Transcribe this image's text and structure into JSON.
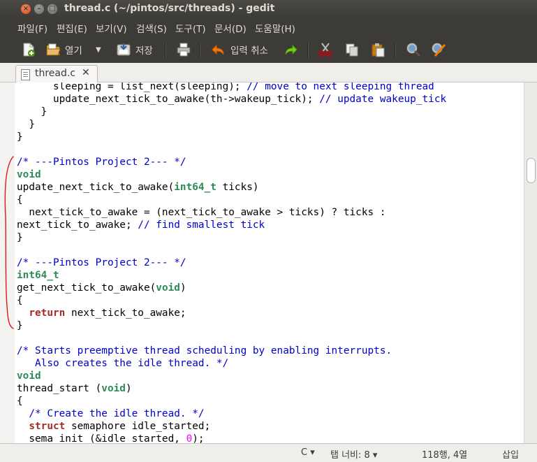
{
  "window": {
    "title": "thread.c (~/pintos/src/threads) - gedit"
  },
  "menu": {
    "items": [
      "파일(F)",
      "편집(E)",
      "보기(V)",
      "검색(S)",
      "도구(T)",
      "문서(D)",
      "도움말(H)"
    ]
  },
  "toolbar": {
    "open_label": "열기",
    "save_label": "저장",
    "undo_label": "입력 취소"
  },
  "tab": {
    "name": "thread.c",
    "close": "✕"
  },
  "code": {
    "lines": [
      [
        {
          "t": "      sleeping = list_next(sleeping); "
        },
        {
          "t": "// move to next sleeping thread",
          "c": "comment"
        }
      ],
      [
        {
          "t": "      update_next_tick_to_awake(th->wakeup_tick); "
        },
        {
          "t": "// update wakeup_tick",
          "c": "comment"
        }
      ],
      [
        {
          "t": "    }"
        }
      ],
      [
        {
          "t": "  }"
        }
      ],
      [
        {
          "t": "}"
        }
      ],
      [
        {
          "t": ""
        }
      ],
      [
        {
          "t": "/* ---Pintos Project 2--- */",
          "c": "comment"
        }
      ],
      [
        {
          "t": "void",
          "c": "type"
        }
      ],
      [
        {
          "t": "update_next_tick_to_awake("
        },
        {
          "t": "int64_t",
          "c": "type"
        },
        {
          "t": " ticks)"
        }
      ],
      [
        {
          "t": "{"
        }
      ],
      [
        {
          "t": "  next_tick_to_awake = (next_tick_to_awake > ticks) ? ticks :"
        }
      ],
      [
        {
          "t": "next_tick_to_awake; "
        },
        {
          "t": "// find smallest tick",
          "c": "comment"
        }
      ],
      [
        {
          "t": "}"
        }
      ],
      [
        {
          "t": ""
        }
      ],
      [
        {
          "t": "/* ---Pintos Project 2--- */",
          "c": "comment"
        }
      ],
      [
        {
          "t": "int64_t",
          "c": "type"
        }
      ],
      [
        {
          "t": "get_next_tick_to_awake("
        },
        {
          "t": "void",
          "c": "type"
        },
        {
          "t": ")"
        }
      ],
      [
        {
          "t": "{"
        }
      ],
      [
        {
          "t": "  "
        },
        {
          "t": "return",
          "c": "kw"
        },
        {
          "t": " next_tick_to_awake;"
        }
      ],
      [
        {
          "t": "}"
        }
      ],
      [
        {
          "t": ""
        }
      ],
      [
        {
          "t": "/* Starts preemptive thread scheduling by enabling interrupts.",
          "c": "comment"
        }
      ],
      [
        {
          "t": "   Also creates the idle thread. */",
          "c": "comment"
        }
      ],
      [
        {
          "t": "void",
          "c": "type"
        }
      ],
      [
        {
          "t": "thread_start ("
        },
        {
          "t": "void",
          "c": "type"
        },
        {
          "t": ")"
        }
      ],
      [
        {
          "t": "{"
        }
      ],
      [
        {
          "t": "  "
        },
        {
          "t": "/* Create the idle thread. */",
          "c": "comment"
        }
      ],
      [
        {
          "t": "  "
        },
        {
          "t": "struct",
          "c": "kw"
        },
        {
          "t": " semaphore idle_started;"
        }
      ],
      [
        {
          "t": "  sema_init (&idle_started, "
        },
        {
          "t": "0",
          "c": "num"
        },
        {
          "t": ");"
        }
      ]
    ]
  },
  "status": {
    "language": "C ▾",
    "tab_width": "탭 너비: 8 ▾",
    "position": "118행, 4열",
    "mode": "삽입"
  },
  "colors": {
    "comment": "#0000c8",
    "type": "#2e8b57",
    "keyword": "#a52a2a",
    "number": "#ff00ff",
    "annotation": "#e0191b"
  }
}
